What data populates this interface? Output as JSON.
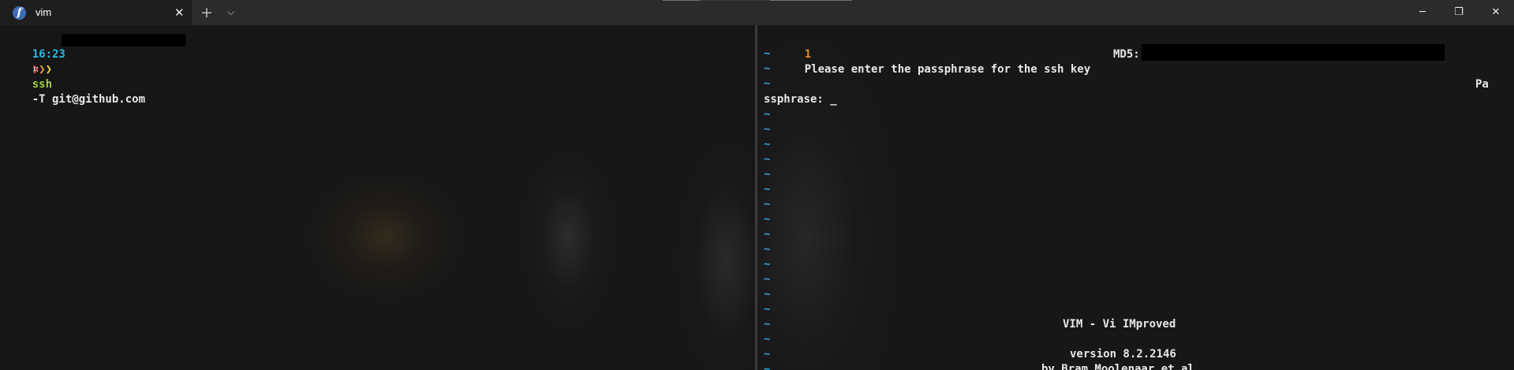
{
  "titlebar": {
    "tab_title": "vim",
    "tab_icon_glyph": "f",
    "tab_icon": "fedora-logo-icon",
    "close_tab": "✕",
    "new_tab": "+",
    "tab_menu": "⌵",
    "minimize": "─",
    "maximize": "❐",
    "close_window": "✕"
  },
  "left_pane": {
    "prompt_time": "16:23",
    "prompt_sep": "¤",
    "chevrons": [
      "❯",
      "❯",
      "❯"
    ],
    "command": "ssh",
    "args": "-T git@github.com"
  },
  "right_pane": {
    "line_number": "1",
    "line1": "Please enter the passphrase for the ssh key",
    "md5_label": "MD5:",
    "pa_fragment": "Pa",
    "prompt": "ssphrase: _",
    "tilde": "~",
    "splash_title": "VIM - Vi IMproved",
    "splash_version": "version 8.2.2146",
    "splash_author": "by Bram Moolenaar et al."
  },
  "colors": {
    "accent_cyan": "#29b8e6",
    "line_number_orange": "#e08a23",
    "command_green": "#9ad13a"
  }
}
